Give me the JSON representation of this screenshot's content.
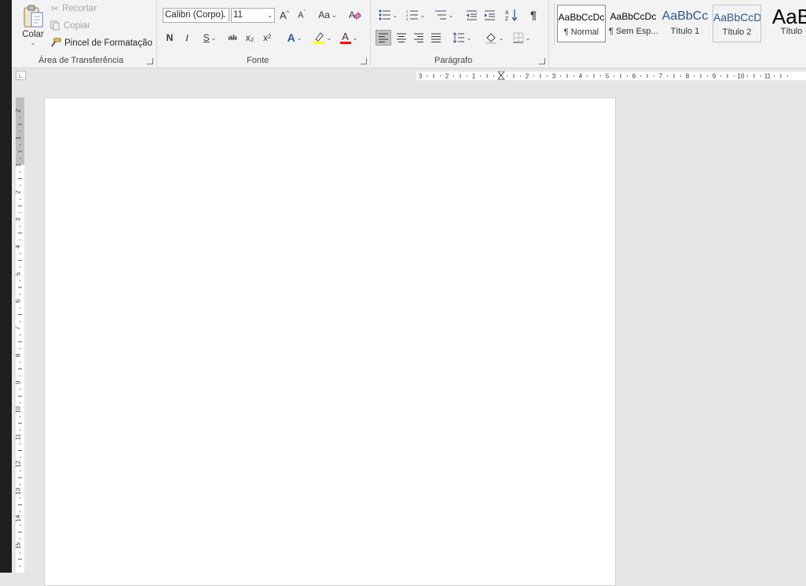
{
  "clipboard": {
    "paste_label": "Colar",
    "cut_label": "Recortar",
    "copy_label": "Copiar",
    "format_painter_label": "Pincel de Formatação",
    "group_label": "Área de Transferência"
  },
  "font": {
    "font_name": "Calibri (Corpo)",
    "font_size": "11",
    "change_case_label": "Aa",
    "bold_label": "N",
    "italic_label": "I",
    "underline_label": "S",
    "strikethrough_label": "ab",
    "subscript_label": "x₂",
    "superscript_label": "x²",
    "text_effects_label": "A",
    "font_color_label": "A",
    "group_label": "Fonte"
  },
  "paragraph": {
    "show_marks_label": "¶",
    "group_label": "Parágrafo"
  },
  "styles": [
    {
      "preview": "AaBbCcDc",
      "name": "¶ Normal"
    },
    {
      "preview": "AaBbCcDc",
      "name": "¶ Sem Esp..."
    },
    {
      "preview": "AaBbCc",
      "name": "Título 1"
    },
    {
      "preview": "AaBbCcD",
      "name": "Título 2"
    },
    {
      "preview": "AaB",
      "name": "Título"
    }
  ],
  "rulers": {
    "horizontal_labels": [
      "3",
      "2",
      "1",
      "1",
      "2",
      "3",
      "4",
      "5",
      "6",
      "7",
      "8",
      "9",
      "10",
      "11"
    ],
    "vertical_labels": [
      "2",
      "1",
      "1",
      "2",
      "3",
      "4",
      "5",
      "6",
      "7",
      "8",
      "9",
      "10",
      "11",
      "12",
      "13",
      "14",
      "15"
    ]
  },
  "colors": {
    "accent_blue": "#2b579a",
    "highlight_yellow": "#ffff00",
    "font_red": "#ff0000",
    "title1_blue": "#2f5496"
  }
}
